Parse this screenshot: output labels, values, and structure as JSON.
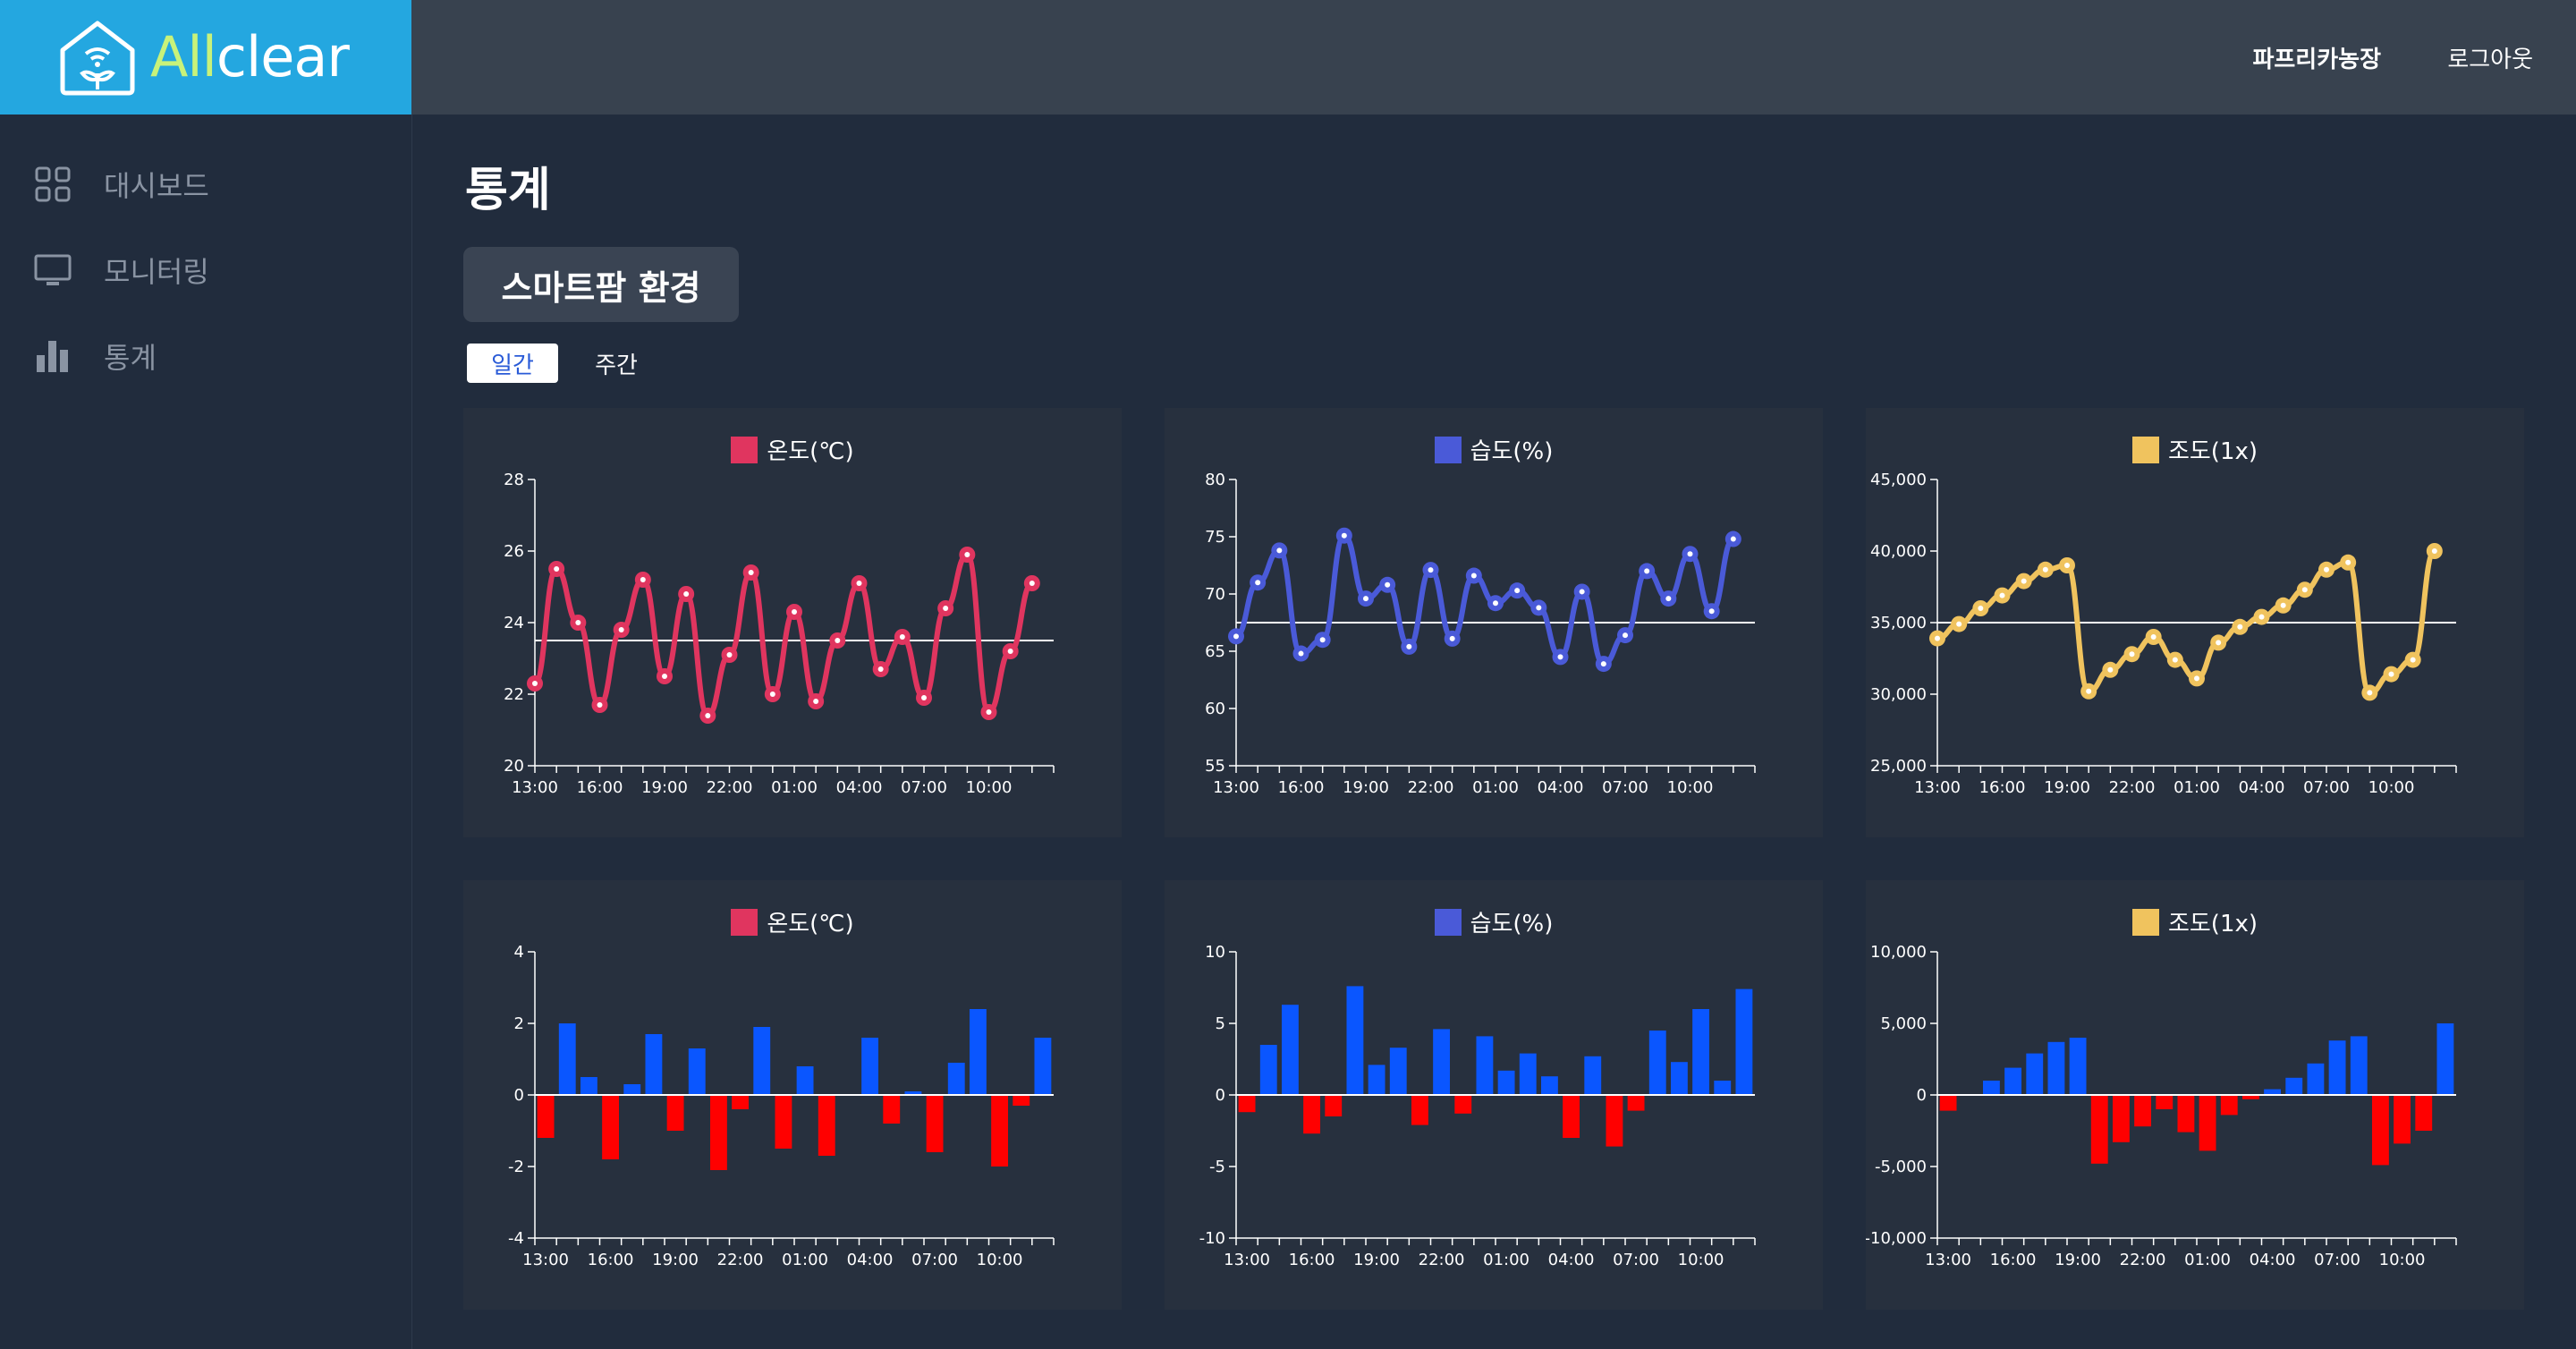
{
  "brand": {
    "text_a": "All",
    "text_b": "clear",
    "color": "#24a7e0",
    "accent": "#c8f27a"
  },
  "header": {
    "farm_name": "파프리카농장",
    "logout": "로그아웃"
  },
  "sidebar": {
    "items": [
      {
        "label": "대시보드",
        "icon": "grid-icon"
      },
      {
        "label": "모니터링",
        "icon": "monitor-icon"
      },
      {
        "label": "통계",
        "icon": "bar-chart-icon"
      }
    ]
  },
  "page": {
    "title": "통계",
    "section": "스마트팜 환경",
    "tabs": [
      {
        "label": "일간",
        "active": true
      },
      {
        "label": "주간",
        "active": false
      }
    ]
  },
  "chart_data": [
    {
      "type": "line",
      "title": "온도(℃)",
      "color": "#e0355f",
      "ylim": [
        20,
        28
      ],
      "yticks": [
        20,
        22,
        24,
        26,
        28
      ],
      "ytick_labels": [
        "20",
        "22",
        "24",
        "26",
        "28"
      ],
      "reference": 23.5,
      "x_labels": [
        "13:00",
        "16:00",
        "19:00",
        "22:00",
        "01:00",
        "04:00",
        "07:00",
        "10:00"
      ],
      "values": [
        22.3,
        25.5,
        24.0,
        21.7,
        23.8,
        25.2,
        22.5,
        24.8,
        21.4,
        23.1,
        25.4,
        22.0,
        24.3,
        21.8,
        23.5,
        25.1,
        22.7,
        23.6,
        21.9,
        24.4,
        25.9,
        21.5,
        23.2,
        25.1
      ]
    },
    {
      "type": "line",
      "title": "습도(%)",
      "color": "#4a5ad8",
      "ylim": [
        55,
        80
      ],
      "yticks": [
        55,
        60,
        65,
        70,
        75,
        80
      ],
      "ytick_labels": [
        "55",
        "60",
        "65",
        "70",
        "75",
        "80"
      ],
      "reference": 67.5,
      "x_labels": [
        "13:00",
        "16:00",
        "19:00",
        "22:00",
        "01:00",
        "04:00",
        "07:00",
        "10:00"
      ],
      "values": [
        66.3,
        71.0,
        73.8,
        64.8,
        66.0,
        75.1,
        69.6,
        70.8,
        65.4,
        72.1,
        66.1,
        71.6,
        69.2,
        70.3,
        68.8,
        64.5,
        70.2,
        63.9,
        66.4,
        72.0,
        69.6,
        73.5,
        68.5,
        74.8
      ]
    },
    {
      "type": "line",
      "title": "조도(1x)",
      "color": "#f0c35e",
      "ylim": [
        25000,
        45000
      ],
      "yticks": [
        25000,
        30000,
        35000,
        40000,
        45000
      ],
      "ytick_labels": [
        "25,000",
        "30,000",
        "35,000",
        "40,000",
        "45,000"
      ],
      "reference": 35000,
      "x_labels": [
        "13:00",
        "16:00",
        "19:00",
        "22:00",
        "01:00",
        "04:00",
        "07:00",
        "10:00"
      ],
      "values": [
        33900,
        34900,
        36000,
        36900,
        37900,
        38700,
        39000,
        30200,
        31700,
        32800,
        34000,
        32400,
        31100,
        33600,
        34700,
        35400,
        36200,
        37300,
        38700,
        39200,
        30100,
        31400,
        32400,
        40000
      ]
    },
    {
      "type": "bar",
      "title": "온도(℃)",
      "color": "#e0355f",
      "ylim": [
        -4,
        4
      ],
      "yticks": [
        -4,
        -2,
        0,
        2,
        4
      ],
      "ytick_labels": [
        "-4",
        "-2",
        "0",
        "2",
        "4"
      ],
      "pos_color": "#0a56ff",
      "neg_color": "#ff0000",
      "x_labels": [
        "13:00",
        "16:00",
        "19:00",
        "22:00",
        "01:00",
        "04:00",
        "07:00",
        "10:00"
      ],
      "values": [
        -1.2,
        2.0,
        0.5,
        -1.8,
        0.3,
        1.7,
        -1.0,
        1.3,
        -2.1,
        -0.4,
        1.9,
        -1.5,
        0.8,
        -1.7,
        0,
        1.6,
        -0.8,
        0.1,
        -1.6,
        0.9,
        2.4,
        -2.0,
        -0.3,
        1.6
      ]
    },
    {
      "type": "bar",
      "title": "습도(%)",
      "color": "#4a5ad8",
      "ylim": [
        -10,
        10
      ],
      "yticks": [
        -10,
        -5,
        0,
        5,
        10
      ],
      "ytick_labels": [
        "-10",
        "-5",
        "0",
        "5",
        "10"
      ],
      "pos_color": "#0a56ff",
      "neg_color": "#ff0000",
      "x_labels": [
        "13:00",
        "16:00",
        "19:00",
        "22:00",
        "01:00",
        "04:00",
        "07:00",
        "10:00"
      ],
      "values": [
        -1.2,
        3.5,
        6.3,
        -2.7,
        -1.5,
        7.6,
        2.1,
        3.3,
        -2.1,
        4.6,
        -1.3,
        4.1,
        1.7,
        2.9,
        1.3,
        -3.0,
        2.7,
        -3.6,
        -1.1,
        4.5,
        2.3,
        6.0,
        1.0,
        7.4
      ]
    },
    {
      "type": "bar",
      "title": "조도(1x)",
      "color": "#f0c35e",
      "ylim": [
        -10000,
        10000
      ],
      "yticks": [
        -10000,
        -5000,
        0,
        5000,
        10000
      ],
      "ytick_labels": [
        "-10,000",
        "-5,000",
        "0",
        "5,000",
        "10,000"
      ],
      "pos_color": "#0a56ff",
      "neg_color": "#ff0000",
      "x_labels": [
        "13:00",
        "16:00",
        "19:00",
        "22:00",
        "01:00",
        "04:00",
        "07:00",
        "10:00"
      ],
      "values": [
        -1100,
        0,
        1000,
        1900,
        2900,
        3700,
        4000,
        -4800,
        -3300,
        -2200,
        -1000,
        -2600,
        -3900,
        -1400,
        -300,
        400,
        1200,
        2200,
        3800,
        4100,
        -4900,
        -3400,
        -2500,
        5000
      ]
    }
  ]
}
